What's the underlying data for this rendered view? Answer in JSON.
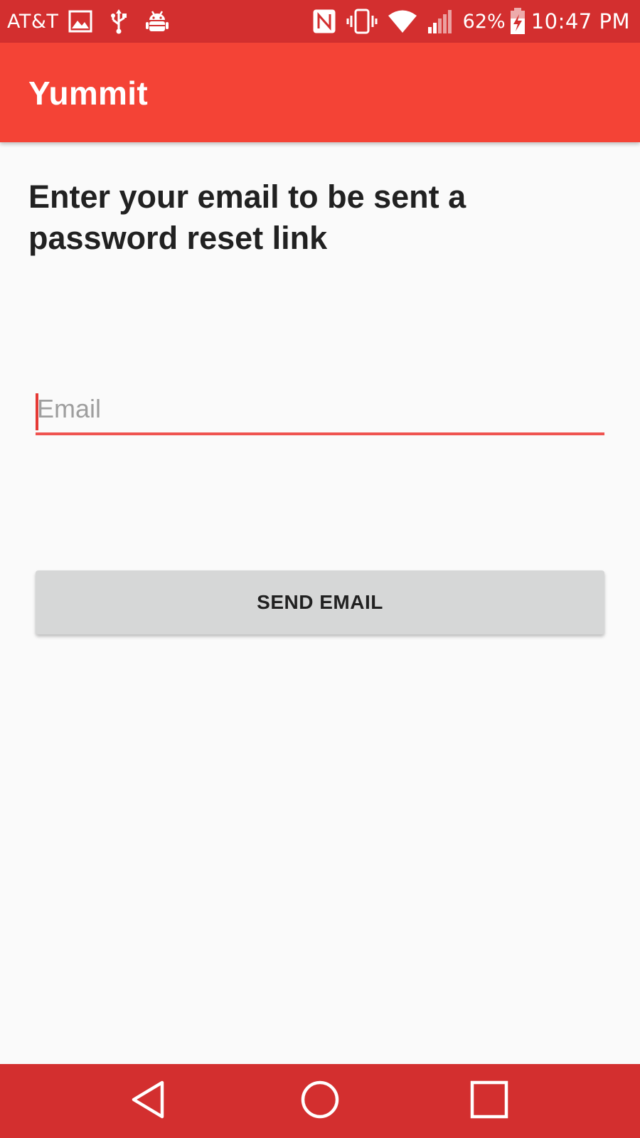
{
  "status_bar": {
    "carrier": "AT&T",
    "battery_percent": "62%",
    "time": "10:47 PM",
    "left_icons": [
      "image-icon",
      "usb-icon",
      "android-debug-icon"
    ],
    "right_icons": [
      "nfc-icon",
      "vibrate-icon",
      "wifi-icon",
      "signal-icon",
      "battery-charging-icon"
    ]
  },
  "app_bar": {
    "title": "Yummit"
  },
  "main": {
    "instructions": "Enter your email to be sent a password reset link",
    "email_field": {
      "placeholder": "Email",
      "value": ""
    },
    "send_button_label": "SEND EMAIL"
  },
  "nav_bar": {
    "buttons": [
      "back-icon",
      "home-icon",
      "recents-icon"
    ]
  },
  "colors": {
    "status_bar": "#d32f2f",
    "app_bar": "#f44336",
    "accent": "#ef5350",
    "background": "#fafafa",
    "button": "#d6d7d7",
    "text": "#212121"
  }
}
